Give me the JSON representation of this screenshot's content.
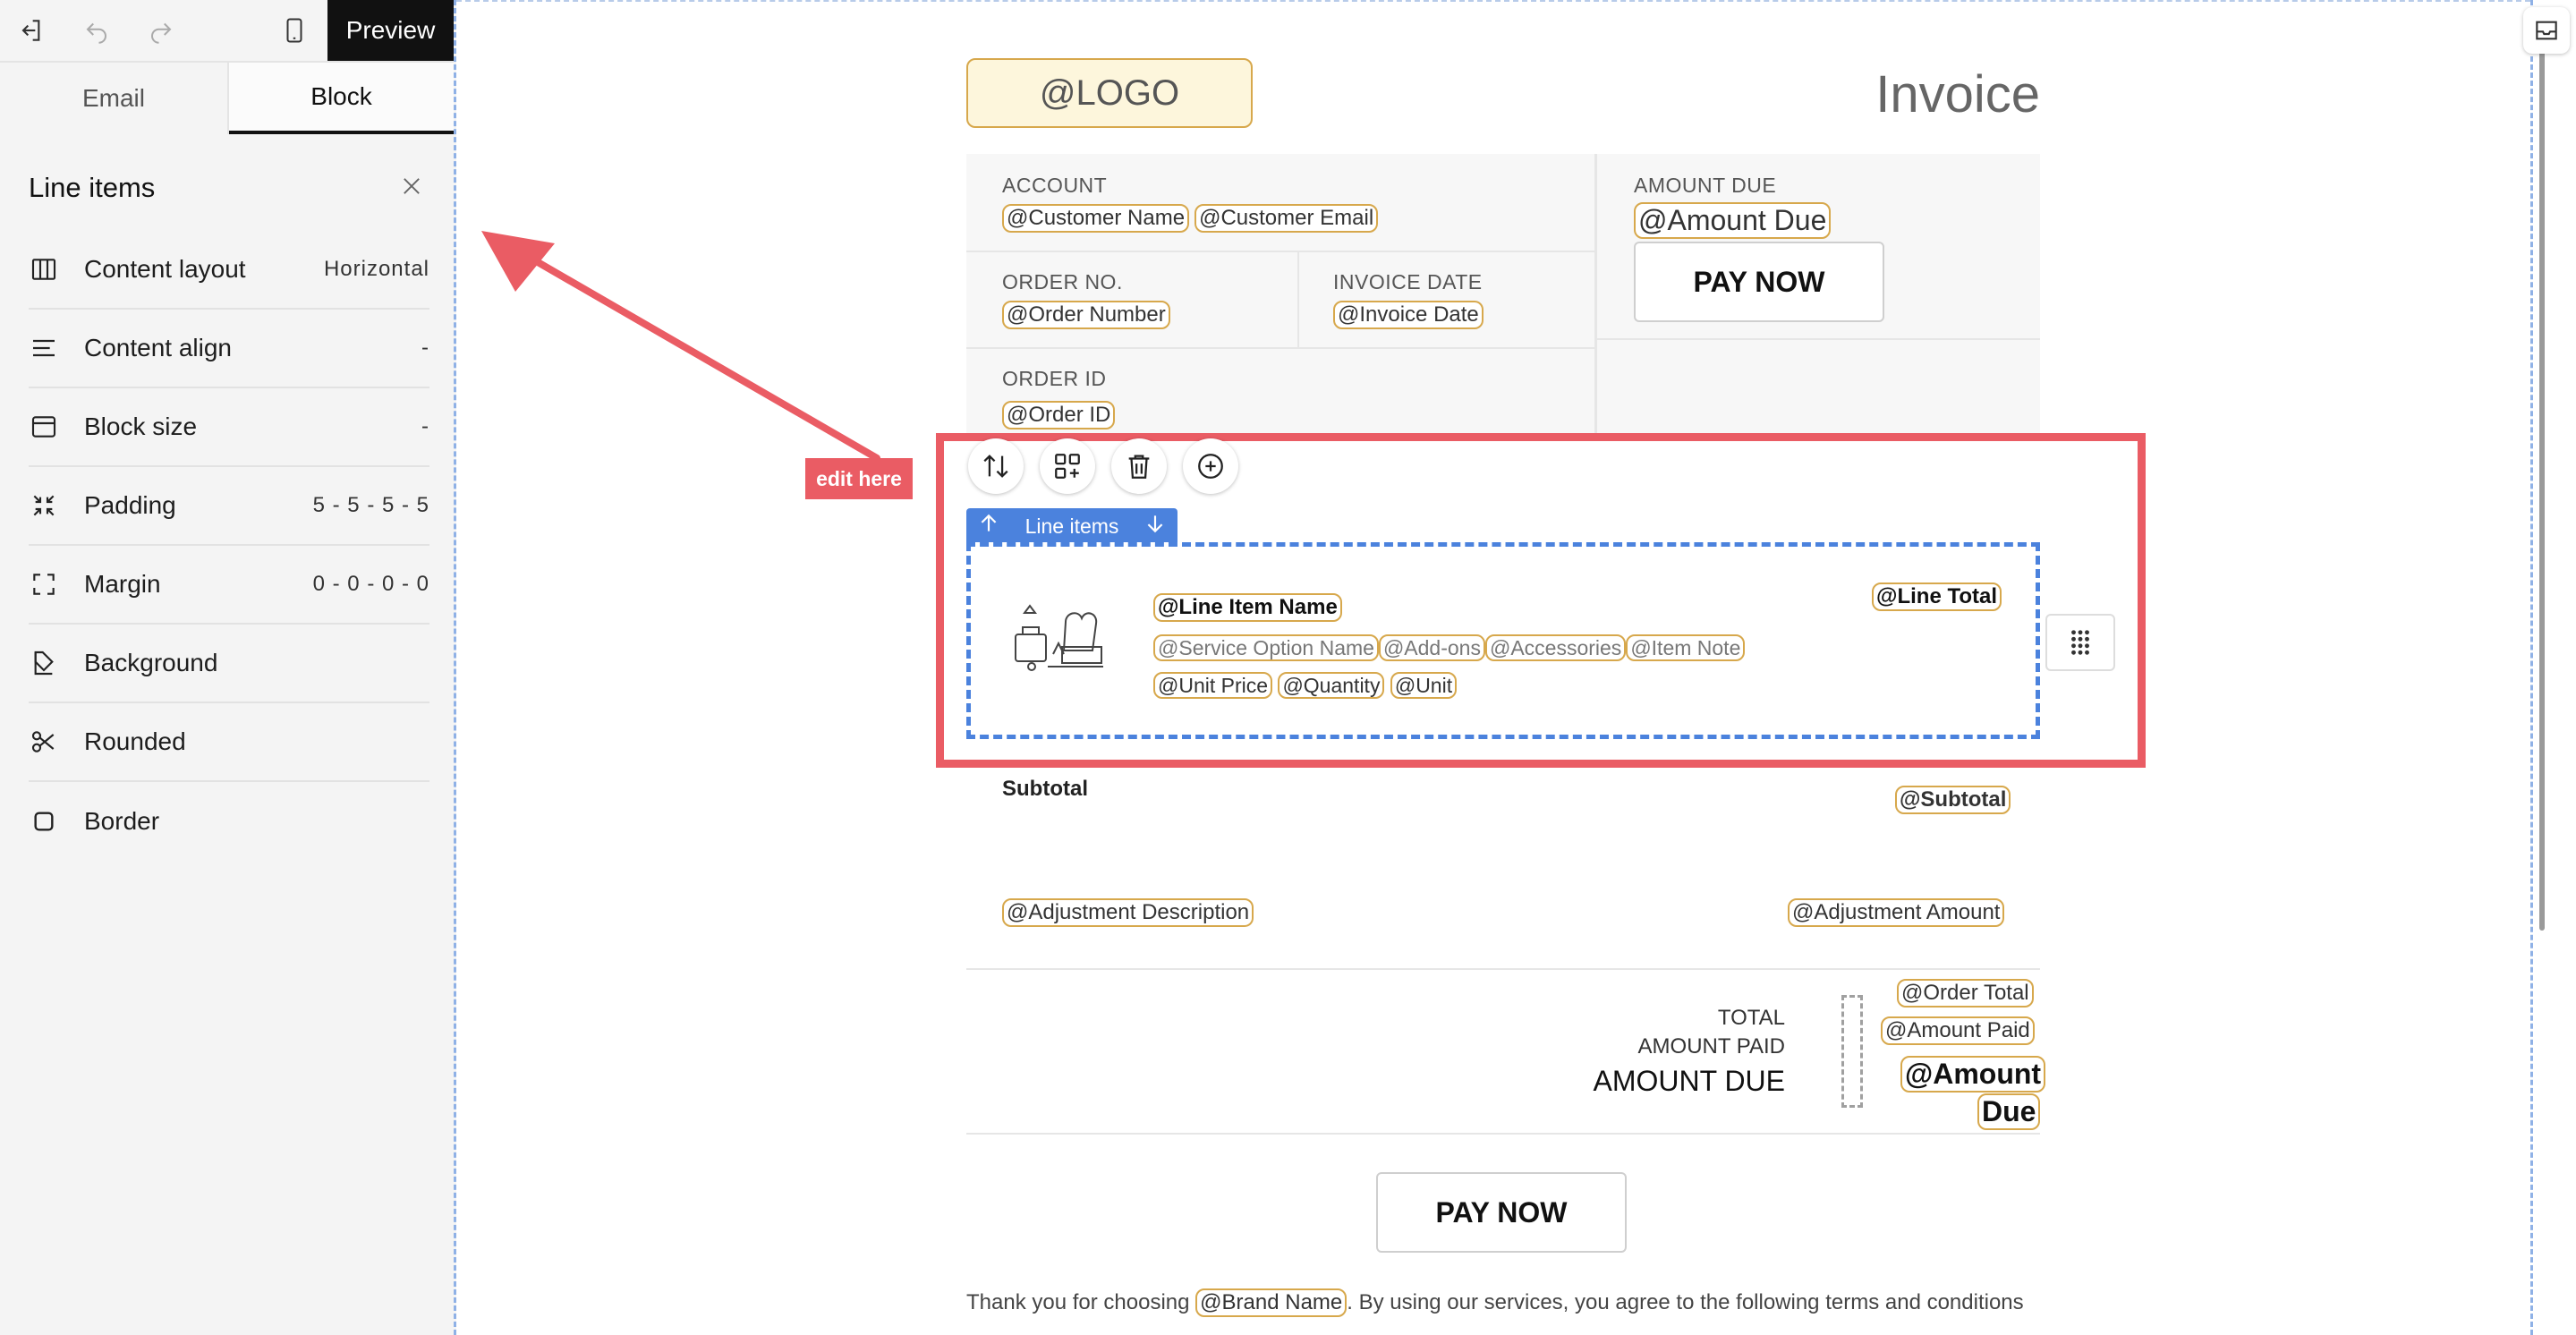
{
  "toolbar": {
    "preview_label": "Preview",
    "icons": [
      "exit-icon",
      "undo-icon",
      "redo-icon",
      "mobile-icon"
    ]
  },
  "tabs": [
    {
      "label": "Email"
    },
    {
      "label": "Block",
      "active": true
    }
  ],
  "panel": {
    "title": "Line items",
    "properties": [
      {
        "label": "Content layout",
        "value": "Horizontal",
        "icon": "columns-icon"
      },
      {
        "label": "Content align",
        "value": "-",
        "icon": "align-left-icon"
      },
      {
        "label": "Block size",
        "value": "-",
        "icon": "window-icon"
      },
      {
        "label": "Padding",
        "value": "5 - 5 - 5 - 5",
        "icon": "shrink-icon"
      },
      {
        "label": "Margin",
        "value": "0 - 0 - 0 - 0",
        "icon": "expand-icon"
      },
      {
        "label": "Background",
        "value": "",
        "icon": "paint-bucket-icon"
      },
      {
        "label": "Rounded",
        "value": "",
        "icon": "scissors-icon"
      },
      {
        "label": "Border",
        "value": "",
        "icon": "square-icon"
      }
    ]
  },
  "annotation": {
    "label": "edit here",
    "color": "#ea5c64"
  },
  "invoice": {
    "logo": "@LOGO",
    "title": "Invoice",
    "account_label": "ACCOUNT",
    "customer_name": "@Customer Name",
    "customer_email": "@Customer Email",
    "amount_due_label": "AMOUNT DUE",
    "amount_due_tag": "@Amount Due",
    "pay_now_label": "PAY NOW",
    "order_no_label": "ORDER NO.",
    "order_number": "@Order Number",
    "invoice_date_label": "INVOICE DATE",
    "invoice_date": "@Invoice Date",
    "order_id_label": "ORDER ID",
    "order_id": "@Order ID",
    "line_items_tag": "Line items",
    "line_item_name": "@Line Item Name",
    "line_total": "@Line Total",
    "options": [
      "@Service Option Name",
      "@Add-ons",
      "@Accessories",
      "@Item Note"
    ],
    "pricing": [
      "@Unit Price",
      "@Quantity",
      "@Unit"
    ],
    "subtotal_label": "Subtotal",
    "subtotal": "@Subtotal",
    "adjustment_description": "@Adjustment Description",
    "adjustment_amount": "@Adjustment Amount",
    "total_label": "TOTAL",
    "amount_paid_label": "AMOUNT PAID",
    "amount_due_big_label": "AMOUNT DUE",
    "order_total": "@Order Total",
    "amount_paid": "@Amount Paid",
    "amount_due_final_1": "@Amount",
    "amount_due_final_2": "Due",
    "pay_now_bottom": "PAY NOW",
    "footer_before": "Thank you for choosing ",
    "brand_name": "@Brand Name",
    "footer_after": ". By using our services, you agree to the following terms and conditions"
  },
  "colors": {
    "accent_blue": "#4b82dd",
    "tag_border": "#d7a84c",
    "highlight_red": "#ea5c64"
  }
}
